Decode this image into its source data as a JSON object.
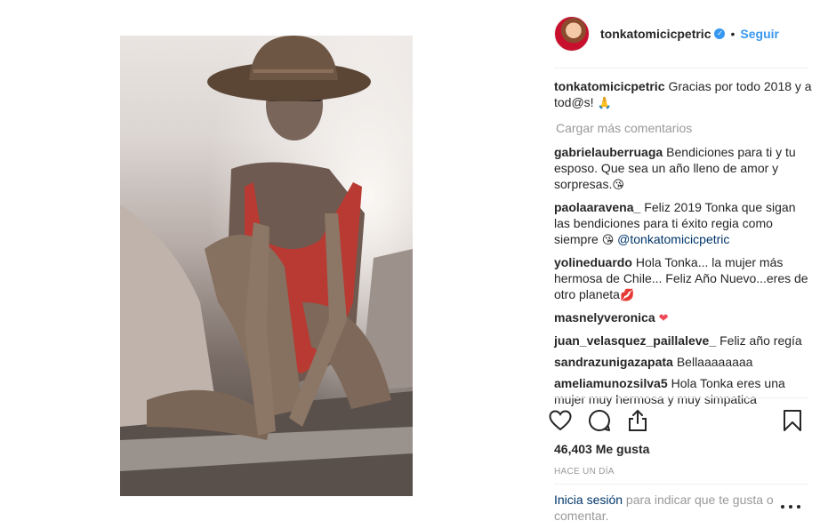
{
  "post": {
    "username": "tonkatomicicpetric",
    "follow_label": "Seguir",
    "dot": "•",
    "caption_user": "tonkatomicicpetric",
    "caption_text": "Gracias por todo 2018 y a tod@s! ",
    "caption_emoji": "🙏",
    "load_more": "Cargar más comentarios",
    "comments": [
      {
        "user": "gabrielauberruaga",
        "text": "Bendiciones para ti y tu esposo. Que sea un año lleno de amor y sorpresas.",
        "emoji": "😘"
      },
      {
        "user": "paolaaravena_",
        "text": "Feliz 2019 Tonka que sigan las bendiciones para ti éxito regia como siempre ",
        "emoji": "😘",
        "mention": " @tonkatomicicpetric"
      },
      {
        "user": "yolineduardo",
        "text": "Hola Tonka... la mujer más hermosa de Chile... Feliz Año Nuevo...eres de otro planeta",
        "emoji": "💋"
      },
      {
        "user": "masnelyveronica",
        "text": "",
        "emoji": "❤"
      },
      {
        "user": "juan_velasquez_paillaleve_",
        "text": "Feliz año regía",
        "emoji": ""
      },
      {
        "user": "sandrazunigazapata",
        "text": "Bellaaaaaaaa",
        "emoji": ""
      },
      {
        "user": "ameliamunozsilva5",
        "text": "Hola Tonka eres una mujer muy hermosa y muy simpatica",
        "emoji": ""
      }
    ],
    "likes": "46,403 Me gusta",
    "time": "HACE UN DÍA",
    "login_link": "Inicia sesión",
    "login_text": " para indicar que te gusta o comentar."
  },
  "icons": {
    "like": "heart-icon",
    "comment": "comment-icon",
    "share": "share-icon",
    "save": "bookmark-icon",
    "more": "more-options-icon",
    "verified": "verified-badge-icon"
  },
  "colors": {
    "accent": "#3897f0",
    "muted": "#999999",
    "link": "#003569",
    "text": "#262626"
  }
}
